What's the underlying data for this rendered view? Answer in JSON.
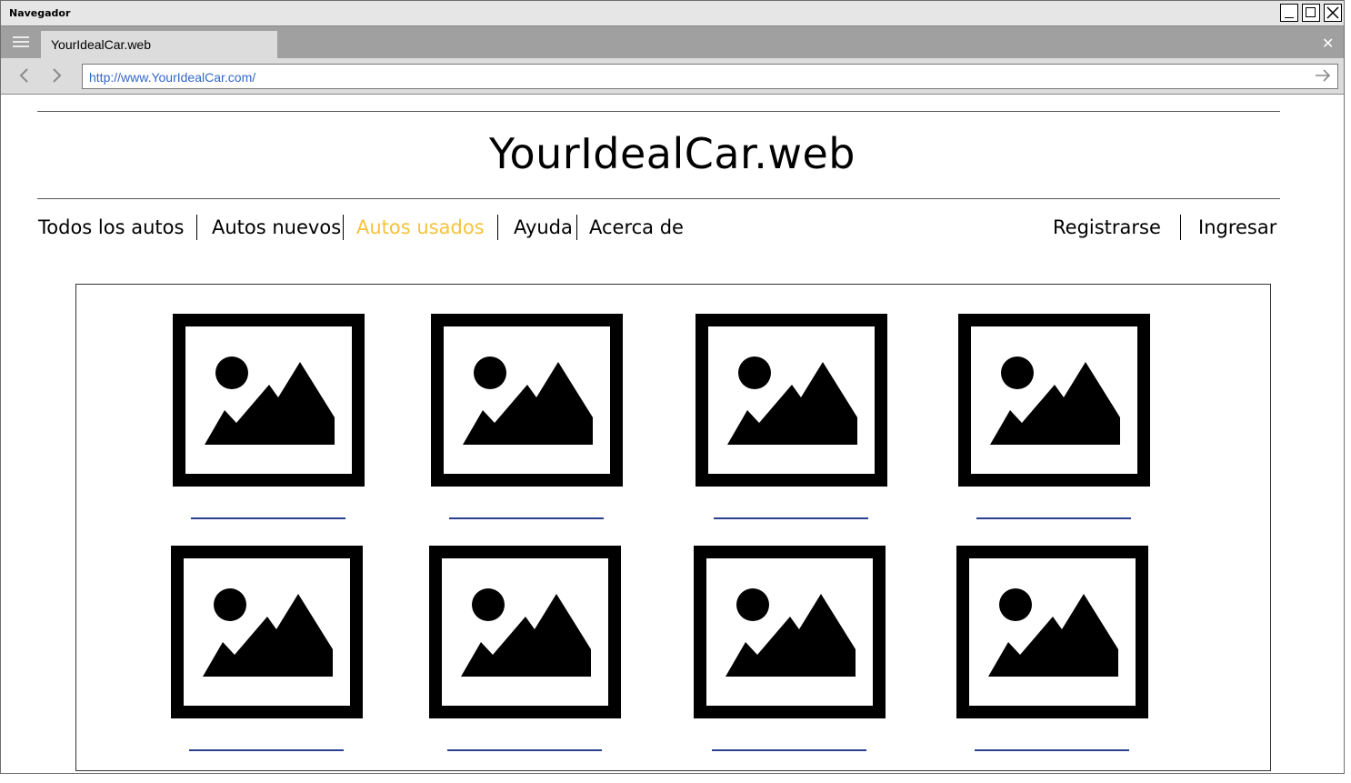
{
  "window": {
    "title": "Navegador"
  },
  "browser": {
    "tab_label": "YourIdealCar.web",
    "url": "http://www.YourIdealCar.com/"
  },
  "site": {
    "title": "YourIdealCar.web",
    "nav": [
      {
        "label": "Todos los autos",
        "active": false
      },
      {
        "label": "Autos nuevos",
        "active": false
      },
      {
        "label": "Autos usados",
        "active": true
      },
      {
        "label": "Ayuda",
        "active": false
      },
      {
        "label": "Acerca de",
        "active": false
      }
    ],
    "account": {
      "register": "Registrarse",
      "login": "Ingresar"
    }
  },
  "gallery": {
    "items": [
      {
        "icon": "image-placeholder-icon"
      },
      {
        "icon": "image-placeholder-icon"
      },
      {
        "icon": "image-placeholder-icon"
      },
      {
        "icon": "image-placeholder-icon"
      },
      {
        "icon": "image-placeholder-icon"
      },
      {
        "icon": "image-placeholder-icon"
      },
      {
        "icon": "image-placeholder-icon"
      },
      {
        "icon": "image-placeholder-icon"
      }
    ]
  },
  "colors": {
    "active_nav": "#f5c33b",
    "link": "#2c3f8f",
    "url_text": "#3366cc"
  }
}
